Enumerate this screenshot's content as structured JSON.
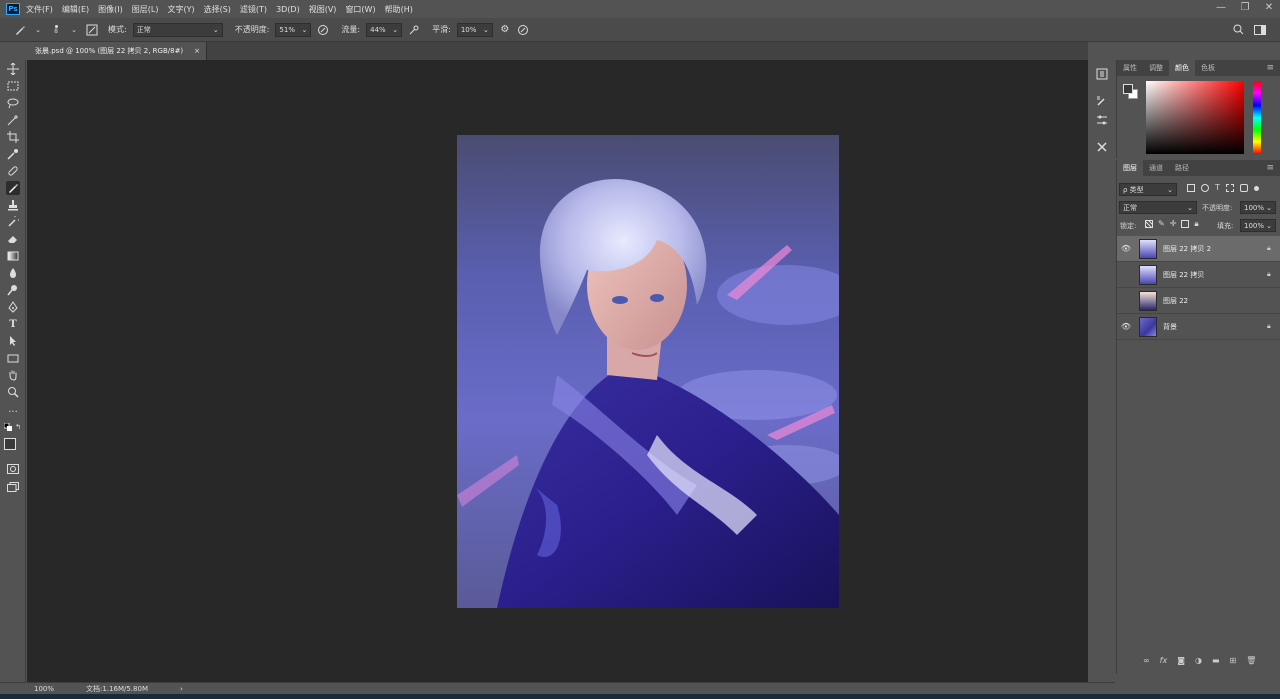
{
  "app": {
    "logo": "Ps",
    "menu": [
      "文件(F)",
      "编辑(E)",
      "图像(I)",
      "图层(L)",
      "文字(Y)",
      "选择(S)",
      "滤镜(T)",
      "3D(D)",
      "视图(V)",
      "窗口(W)",
      "帮助(H)"
    ],
    "window_controls": [
      "—",
      "❐",
      "✕"
    ]
  },
  "options": {
    "brush_size": "8",
    "mode_label": "模式:",
    "mode_value": "正常",
    "opacity_label": "不透明度:",
    "opacity_value": "51%",
    "flow_label": "流量:",
    "flow_value": "44%",
    "smooth_label": "平滑:",
    "smooth_value": "10%"
  },
  "document": {
    "tab_title": "张晨.psd @ 100% (图层 22 拷贝 2, RGB/8#)",
    "tab_close": "×"
  },
  "status": {
    "zoom": "100%",
    "doc_info": "文档:1.16M/5.80M",
    "arrow": "›"
  },
  "color_panel": {
    "tabs": [
      "属性",
      "调整",
      "颜色",
      "色板"
    ],
    "active_tab": 2,
    "hue_bar_colors": [
      "#ff0000",
      "#ff00ff",
      "#0000ff",
      "#00ffff",
      "#00ff00",
      "#ffff00",
      "#ff0000"
    ],
    "field_color": "#ff0000"
  },
  "layers_panel": {
    "tabs": [
      "图层",
      "通道",
      "路径"
    ],
    "active_tab": 0,
    "filter_label": "ρ 类型",
    "blend_mode": "正常",
    "opacity_label": "不透明度:",
    "opacity_value": "100%",
    "lock_label": "锁定:",
    "fill_label": "填充:",
    "fill_value": "100%",
    "layers": [
      {
        "name": "图层 22 拷贝 2",
        "visible": true,
        "selected": true,
        "locked": true
      },
      {
        "name": "图层 22 拷贝",
        "visible": false,
        "selected": false,
        "locked": true
      },
      {
        "name": "图层 22",
        "visible": false,
        "selected": false,
        "locked": false
      },
      {
        "name": "背景",
        "visible": true,
        "selected": false,
        "locked": true
      }
    ],
    "footer_icons": [
      "link-icon",
      "fx-icon",
      "mask-icon",
      "adjustment-icon",
      "folder-icon",
      "new-layer-icon",
      "trash-icon"
    ]
  }
}
